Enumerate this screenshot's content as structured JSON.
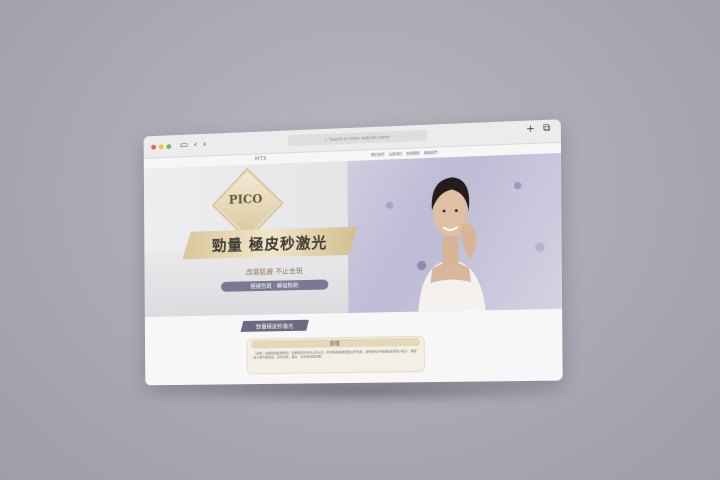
{
  "browser": {
    "url_placeholder": "Search or enter website name",
    "traffic_lights": [
      "#ee5d50",
      "#f6be3a",
      "#5fc454"
    ]
  },
  "site": {
    "logo": "MTX",
    "menu": [
      "關於我們",
      "治療項目",
      "醫師團隊",
      "聯絡我們"
    ]
  },
  "hero": {
    "badge": "PICO",
    "title": "勁量 極皮秒激光",
    "subtitle": "改寫肌膚 不止去斑",
    "pill": "極褪色斑 · 解痘粉刺"
  },
  "section": {
    "tag": "勁量極皮秒激光",
    "box_title": "原理",
    "box_text": "『皮秒』是極短的脈衝時間，勁量極皮秒激光以兆分之一秒的脈衝將能量集中於色素，使色素粒子瞬間擊碎成微小粒子，再經由人體代謝排出，達到淡斑、美白、改善膚質等效果。"
  }
}
